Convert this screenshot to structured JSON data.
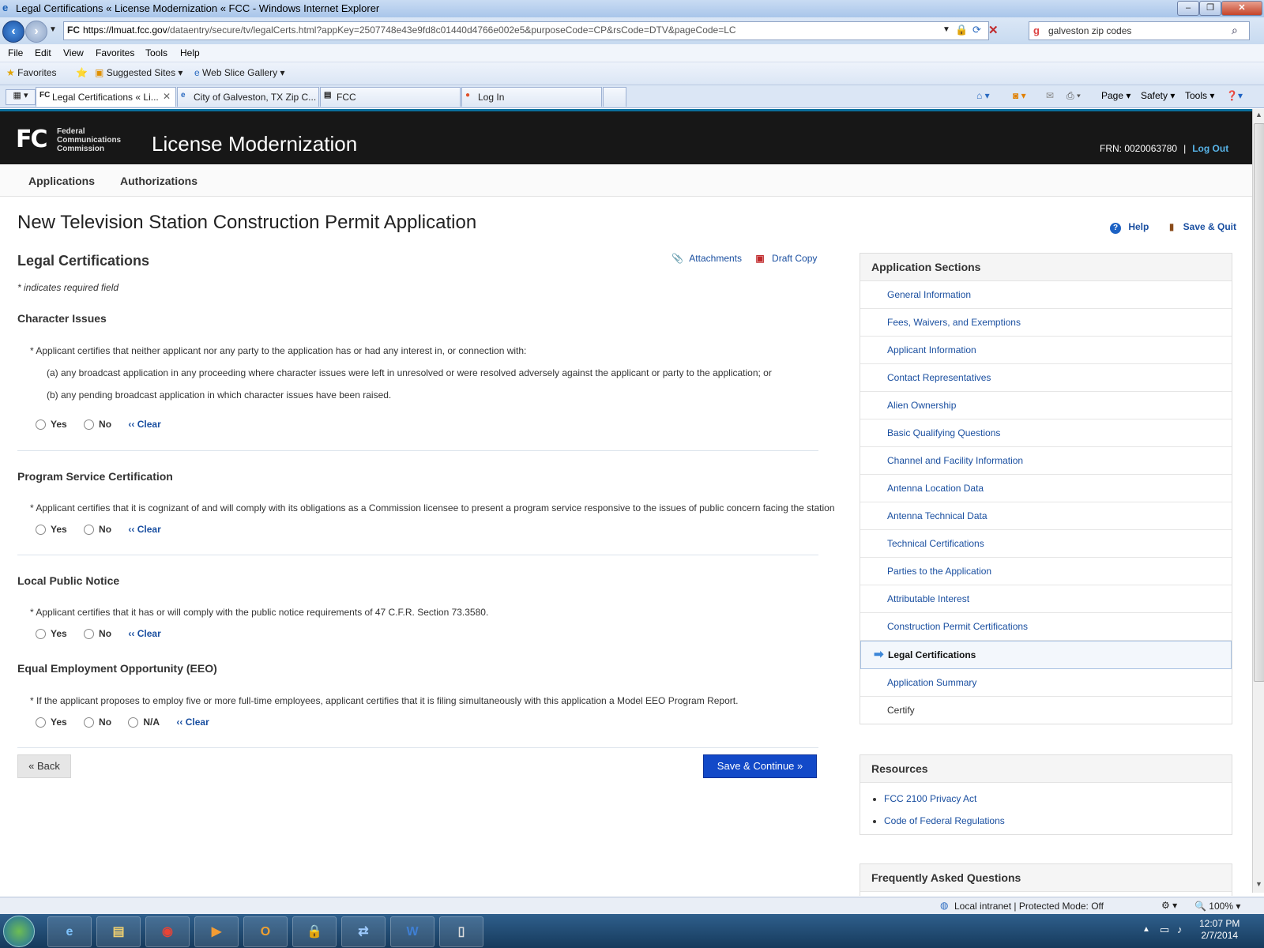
{
  "browser": {
    "window_title": "Legal Certifications « License Modernization « FCC - Windows Internet Explorer",
    "url_host": "https://lmuat.fcc.gov",
    "url_path": "/dataentry/secure/tv/legalCerts.html?appKey=2507748e43e9fd8c01440d4766e002e5&purposeCode=CP&rsCode=DTV&pageCode=LC",
    "search_value": "galveston zip codes",
    "menu": [
      "File",
      "Edit",
      "View",
      "Favorites",
      "Tools",
      "Help"
    ],
    "favorites_label": "Favorites",
    "suggested_sites": "Suggested Sites ▾",
    "web_slice_gallery": "Web Slice Gallery ▾",
    "tabs": [
      {
        "label": "Legal Certifications « Li..."
      },
      {
        "label": "City of Galveston, TX Zip C..."
      },
      {
        "label": "FCC"
      },
      {
        "label": "Log In"
      }
    ],
    "commands": {
      "page": "Page ▾",
      "safety": "Safety ▾",
      "tools": "Tools ▾"
    },
    "status_zone": "Local intranet | Protected Mode: Off",
    "zoom": "100%"
  },
  "site": {
    "agency_lines": [
      "Federal",
      "Communications",
      "Commission"
    ],
    "title": "License Modernization",
    "frn": "FRN: 0020063780",
    "separator": "|",
    "logout": "Log Out",
    "nav": [
      "Applications",
      "Authorizations"
    ]
  },
  "page": {
    "title": "New Television Station Construction Permit Application",
    "help": "Help",
    "save_quit": "Save & Quit",
    "section_title": "Legal Certifications",
    "attachments": "Attachments",
    "draft_copy": "Draft Copy",
    "required_note": "* indicates required field",
    "questions": {
      "character": {
        "heading": "Character Issues",
        "text": "* Applicant certifies that neither applicant nor any party to the application has or had any interest in, or connection with:",
        "a": "(a)  any broadcast application in any proceeding where character issues were left in unresolved or were resolved adversely against the applicant or party to the application; or",
        "b": "(b)  any pending broadcast application in which character issues have been raised."
      },
      "program": {
        "heading": "Program Service Certification",
        "text": "* Applicant certifies that it is cognizant of and will comply with its obligations as a Commission licensee to present a program service responsive to the issues of public concern facing the station"
      },
      "notice": {
        "heading": "Local Public Notice",
        "text": "* Applicant certifies that it has or will comply with the public notice requirements of 47 C.F.R. Section 73.3580."
      },
      "eeo": {
        "heading": "Equal Employment Opportunity (EEO)",
        "text": "* If the applicant proposes to employ five or more full-time employees, applicant certifies that it is filing simultaneously with this application a Model EEO Program Report."
      }
    },
    "radio": {
      "yes": "Yes",
      "no": "No",
      "na": "N/A",
      "clear": "‹‹ Clear"
    },
    "back": "« Back",
    "save_continue": "Save & Continue »"
  },
  "sidebar": {
    "sections_title": "Application Sections",
    "sections": [
      "General Information",
      "Fees, Waivers, and Exemptions",
      "Applicant Information",
      "Contact Representatives",
      "Alien Ownership",
      "Basic Qualifying Questions",
      "Channel and Facility Information",
      "Antenna Location Data",
      "Antenna Technical Data",
      "Technical Certifications",
      "Parties to the Application",
      "Attributable Interest",
      "Construction Permit Certifications",
      "Legal Certifications",
      "Application Summary",
      "Certify"
    ],
    "resources_title": "Resources",
    "resources": [
      "FCC 2100 Privacy Act",
      "Code of Federal Regulations"
    ],
    "faq_title": "Frequently Asked Questions"
  },
  "taskbar": {
    "time": "12:07 PM",
    "date": "2/7/2014"
  }
}
